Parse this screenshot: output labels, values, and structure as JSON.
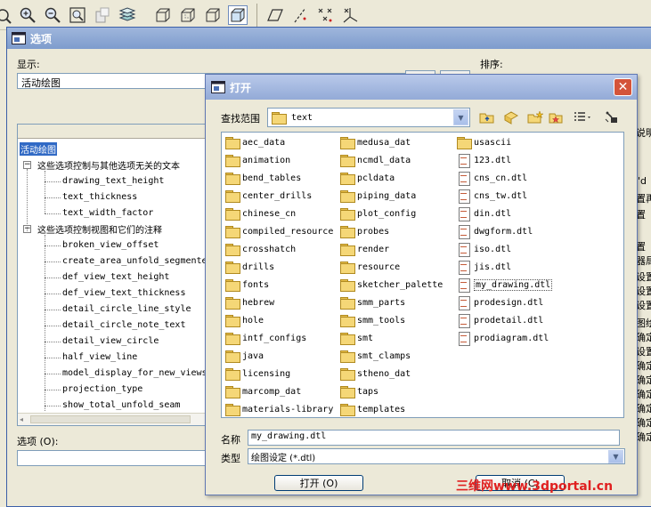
{
  "options_dialog": {
    "title": "选项",
    "display_label": "显示:",
    "display_value": "活动绘图",
    "sort_label": "排序:",
    "option_label": "选项 (O):",
    "tree": {
      "root": "活动绘图",
      "group1": {
        "label": "这些选项控制与其他选项无关的文本",
        "items": [
          "drawing_text_height",
          "text_thickness",
          "text_width_factor"
        ]
      },
      "group2": {
        "label": "这些选项控制视图和它们的注释",
        "items": [
          "broken_view_offset",
          "create_area_unfold_segmented",
          "def_view_text_height",
          "def_view_text_thickness",
          "detail_circle_line_style",
          "detail_circle_note_text",
          "detail_view_circle",
          "half_view_line",
          "model_display_for_new_views",
          "projection_type",
          "show_total_unfold_seam"
        ]
      }
    },
    "right_fragments": [
      "说明",
      "\"d",
      "置再",
      "置",
      "置",
      "器局",
      "设置",
      "设置",
      "设置",
      "图绘",
      "确定",
      "设置",
      "确定",
      "确定",
      "确定",
      "确定",
      "确定",
      "确定"
    ]
  },
  "open_dialog": {
    "title": "打开",
    "lookin_label": "查找范围",
    "lookin_value": "text",
    "filename_label": "名称",
    "filename_value": "my_drawing.dtl",
    "filetype_label": "类型",
    "filetype_value": "绘图设定 (*.dtl)",
    "open_button": "打开 (O)",
    "cancel_button": "取消 (C)",
    "columns": [
      [
        {
          "name": "aec_data",
          "type": "folder"
        },
        {
          "name": "animation",
          "type": "folder"
        },
        {
          "name": "bend_tables",
          "type": "folder"
        },
        {
          "name": "center_drills",
          "type": "folder"
        },
        {
          "name": "chinese_cn",
          "type": "folder"
        },
        {
          "name": "compiled_resource",
          "type": "folder"
        },
        {
          "name": "crosshatch",
          "type": "folder"
        },
        {
          "name": "drills",
          "type": "folder"
        },
        {
          "name": "fonts",
          "type": "folder"
        },
        {
          "name": "hebrew",
          "type": "folder"
        },
        {
          "name": "hole",
          "type": "folder"
        },
        {
          "name": "intf_configs",
          "type": "folder"
        },
        {
          "name": "java",
          "type": "folder"
        },
        {
          "name": "licensing",
          "type": "folder"
        },
        {
          "name": "marcomp_dat",
          "type": "folder"
        },
        {
          "name": "materials-library",
          "type": "folder"
        }
      ],
      [
        {
          "name": "medusa_dat",
          "type": "folder"
        },
        {
          "name": "ncmdl_data",
          "type": "folder"
        },
        {
          "name": "pcldata",
          "type": "folder"
        },
        {
          "name": "piping_data",
          "type": "folder"
        },
        {
          "name": "plot_config",
          "type": "folder"
        },
        {
          "name": "probes",
          "type": "folder"
        },
        {
          "name": "render",
          "type": "folder"
        },
        {
          "name": "resource",
          "type": "folder"
        },
        {
          "name": "sketcher_palette",
          "type": "folder"
        },
        {
          "name": "smm_parts",
          "type": "folder"
        },
        {
          "name": "smm_tools",
          "type": "folder"
        },
        {
          "name": "smt",
          "type": "folder"
        },
        {
          "name": "smt_clamps",
          "type": "folder"
        },
        {
          "name": "stheno_dat",
          "type": "folder"
        },
        {
          "name": "taps",
          "type": "folder"
        },
        {
          "name": "templates",
          "type": "folder"
        }
      ],
      [
        {
          "name": "usascii",
          "type": "folder"
        },
        {
          "name": "123.dtl",
          "type": "file"
        },
        {
          "name": "cns_cn.dtl",
          "type": "file"
        },
        {
          "name": "cns_tw.dtl",
          "type": "file"
        },
        {
          "name": "din.dtl",
          "type": "file"
        },
        {
          "name": "dwgform.dtl",
          "type": "file"
        },
        {
          "name": "iso.dtl",
          "type": "file"
        },
        {
          "name": "jis.dtl",
          "type": "file"
        },
        {
          "name": "my_drawing.dtl",
          "type": "file",
          "selected": true
        },
        {
          "name": "prodesign.dtl",
          "type": "file"
        },
        {
          "name": "prodetail.dtl",
          "type": "file"
        },
        {
          "name": "prodiagram.dtl",
          "type": "file"
        }
      ]
    ]
  },
  "watermark": "三维网www.3dportal.cn",
  "colors": {
    "dialog_bg": "#ece9d8",
    "selection_bg": "#316ac5",
    "titlebar": "#7e9ccd",
    "close_button": "#d4543a",
    "watermark": "#e02020"
  }
}
